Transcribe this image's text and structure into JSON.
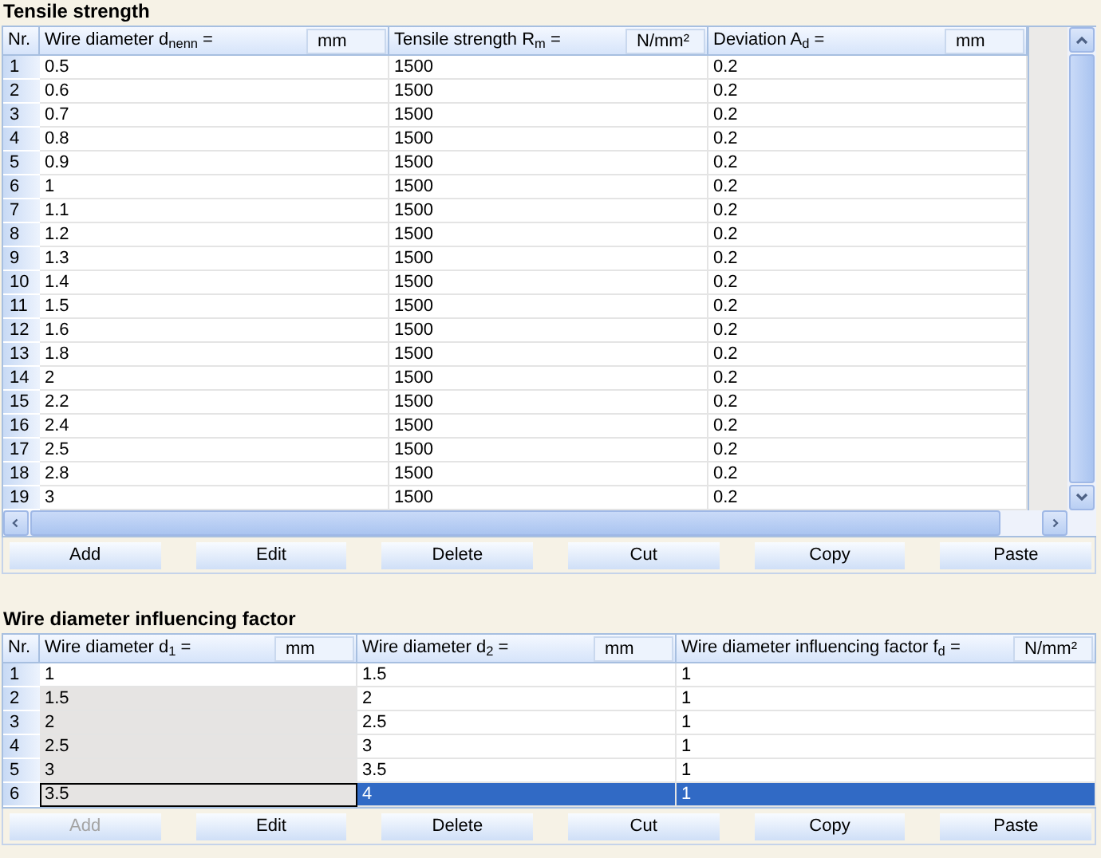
{
  "sections": [
    {
      "title": "Tensile strength",
      "table": {
        "number_heading": "Nr.",
        "columns": [
          {
            "label": "Wire diameter d$_{nenn}$ =",
            "unit": "mm"
          },
          {
            "label": "Tensile strength R$_{m}$ =",
            "unit": "N/mm²"
          },
          {
            "label": "Deviation A$_{d}$ =",
            "unit": "mm"
          }
        ],
        "rows": [
          {
            "nr": "1",
            "cells": [
              "0.5",
              "1500",
              "0.2"
            ],
            "selected": false,
            "locked": false
          },
          {
            "nr": "2",
            "cells": [
              "0.6",
              "1500",
              "0.2"
            ],
            "selected": false,
            "locked": false
          },
          {
            "nr": "3",
            "cells": [
              "0.7",
              "1500",
              "0.2"
            ],
            "selected": false,
            "locked": false
          },
          {
            "nr": "4",
            "cells": [
              "0.8",
              "1500",
              "0.2"
            ],
            "selected": false,
            "locked": false
          },
          {
            "nr": "5",
            "cells": [
              "0.9",
              "1500",
              "0.2"
            ],
            "selected": false,
            "locked": false
          },
          {
            "nr": "6",
            "cells": [
              "1",
              "1500",
              "0.2"
            ],
            "selected": false,
            "locked": false
          },
          {
            "nr": "7",
            "cells": [
              "1.1",
              "1500",
              "0.2"
            ],
            "selected": false,
            "locked": false
          },
          {
            "nr": "8",
            "cells": [
              "1.2",
              "1500",
              "0.2"
            ],
            "selected": false,
            "locked": false
          },
          {
            "nr": "9",
            "cells": [
              "1.3",
              "1500",
              "0.2"
            ],
            "selected": false,
            "locked": false
          },
          {
            "nr": "10",
            "cells": [
              "1.4",
              "1500",
              "0.2"
            ],
            "selected": false,
            "locked": false
          },
          {
            "nr": "11",
            "cells": [
              "1.5",
              "1500",
              "0.2"
            ],
            "selected": false,
            "locked": false
          },
          {
            "nr": "12",
            "cells": [
              "1.6",
              "1500",
              "0.2"
            ],
            "selected": false,
            "locked": false
          },
          {
            "nr": "13",
            "cells": [
              "1.8",
              "1500",
              "0.2"
            ],
            "selected": false,
            "locked": false
          },
          {
            "nr": "14",
            "cells": [
              "2",
              "1500",
              "0.2"
            ],
            "selected": false,
            "locked": false
          },
          {
            "nr": "15",
            "cells": [
              "2.2",
              "1500",
              "0.2"
            ],
            "selected": false,
            "locked": false
          },
          {
            "nr": "16",
            "cells": [
              "2.4",
              "1500",
              "0.2"
            ],
            "selected": false,
            "locked": false
          },
          {
            "nr": "17",
            "cells": [
              "2.5",
              "1500",
              "0.2"
            ],
            "selected": false,
            "locked": false
          },
          {
            "nr": "18",
            "cells": [
              "2.8",
              "1500",
              "0.2"
            ],
            "selected": false,
            "locked": false
          },
          {
            "nr": "19",
            "cells": [
              "3",
              "1500",
              "0.2"
            ],
            "selected": false,
            "locked": false
          }
        ],
        "scrollbars": true
      },
      "buttons": [
        {
          "label": "Add",
          "disabled": false
        },
        {
          "label": "Edit",
          "disabled": false
        },
        {
          "label": "Delete",
          "disabled": false
        },
        {
          "label": "Cut",
          "disabled": false
        },
        {
          "label": "Copy",
          "disabled": false
        },
        {
          "label": "Paste",
          "disabled": false
        }
      ]
    },
    {
      "title": "Wire diameter influencing factor",
      "table": {
        "number_heading": "Nr.",
        "columns": [
          {
            "label": "Wire diameter d$_{1}$ =",
            "unit": "mm"
          },
          {
            "label": "Wire diameter d$_{2}$ =",
            "unit": "mm"
          },
          {
            "label": "Wire diameter influencing factor f$_{d}$ =",
            "unit": "N/mm²"
          }
        ],
        "rows": [
          {
            "nr": "1",
            "cells": [
              "1",
              "1.5",
              "1"
            ],
            "selected": false,
            "locked": false
          },
          {
            "nr": "2",
            "cells": [
              "1.5",
              "2",
              "1"
            ],
            "selected": false,
            "locked": true
          },
          {
            "nr": "3",
            "cells": [
              "2",
              "2.5",
              "1"
            ],
            "selected": false,
            "locked": true
          },
          {
            "nr": "4",
            "cells": [
              "2.5",
              "3",
              "1"
            ],
            "selected": false,
            "locked": true
          },
          {
            "nr": "5",
            "cells": [
              "3",
              "3.5",
              "1"
            ],
            "selected": false,
            "locked": true
          },
          {
            "nr": "6",
            "cells": [
              "3.5",
              "4",
              "1"
            ],
            "selected": true,
            "locked": true
          }
        ],
        "scrollbars": false
      },
      "buttons": [
        {
          "label": "Add",
          "disabled": true
        },
        {
          "label": "Edit",
          "disabled": false
        },
        {
          "label": "Delete",
          "disabled": false
        },
        {
          "label": "Cut",
          "disabled": false
        },
        {
          "label": "Copy",
          "disabled": false
        },
        {
          "label": "Paste",
          "disabled": false
        }
      ]
    }
  ]
}
